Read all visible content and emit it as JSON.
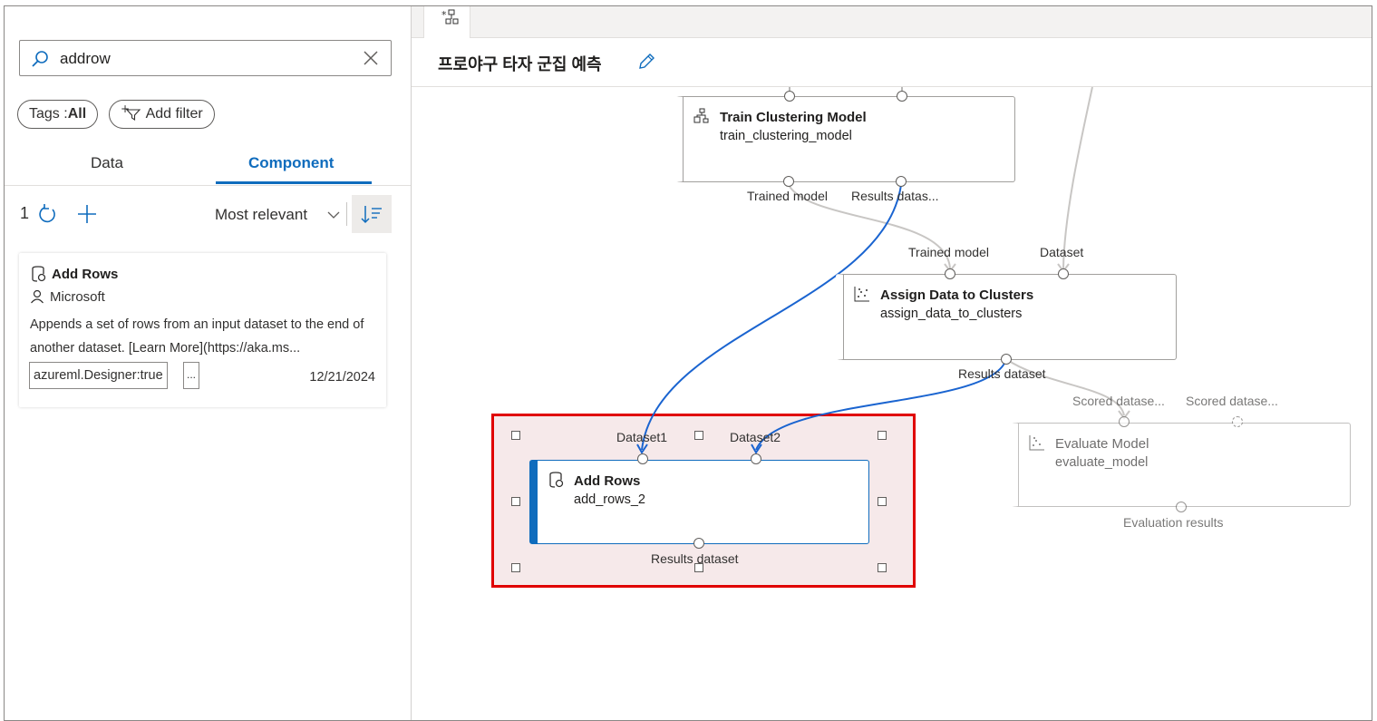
{
  "search": {
    "value": "addrow"
  },
  "filters": {
    "tags_label": "Tags :",
    "tags_value": "All",
    "add_filter": "Add filter"
  },
  "tabs": [
    {
      "label": "Data"
    },
    {
      "label": "Component"
    }
  ],
  "results": {
    "count": "1",
    "sort_label": "Most relevant"
  },
  "card": {
    "title": "Add Rows",
    "publisher": "Microsoft",
    "description": "Appends a set of rows from an input dataset to the end of another dataset. [Learn More](https://aka.ms...",
    "tag": "azureml.Designer:true",
    "more": "...",
    "date": "12/21/2024"
  },
  "pipeline": {
    "title": "프로야구 타자 군집 예측"
  },
  "nodes": {
    "train": {
      "title": "Train Clustering Model",
      "sub": "train_clustering_model",
      "out1": "Trained model",
      "out2": "Results datas..."
    },
    "assign": {
      "title": "Assign Data to Clusters",
      "sub": "assign_data_to_clusters",
      "in1": "Trained model",
      "in2": "Dataset",
      "out1": "Results dataset"
    },
    "evaluate": {
      "title": "Evaluate Model",
      "sub": "evaluate_model",
      "in1": "Scored datase...",
      "in2": "Scored datase...",
      "out1": "Evaluation results"
    },
    "addrows": {
      "title": "Add Rows",
      "sub": "add_rows_2",
      "in1": "Dataset1",
      "in2": "Dataset2",
      "out1": "Results dataset"
    }
  },
  "colors": {
    "accent": "#0f6cbd",
    "wire_selected": "#1a64d0",
    "wire": "#c8c6c4",
    "selection": "#e00000"
  },
  "icons": [
    "search-icon",
    "close-icon",
    "filter-icon",
    "refresh-icon",
    "plus-icon",
    "chevron-down-icon",
    "sort-icon",
    "component-icon",
    "person-icon",
    "pipeline-icon",
    "pencil-icon",
    "cluster-icon"
  ]
}
